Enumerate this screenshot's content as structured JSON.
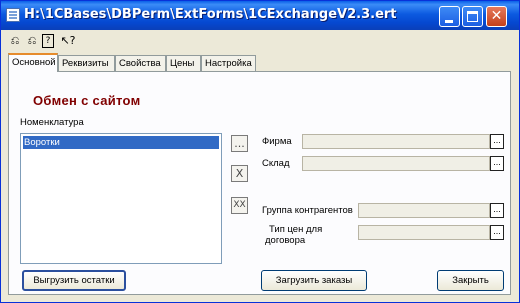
{
  "window": {
    "title": "H:\\1CBases\\DBPerm\\ExtForms\\1CExchangeV2.3.ert",
    "close_glyph": "✕"
  },
  "toolbar": {
    "icons": [
      "⎌",
      "⎌",
      "?",
      "↖?"
    ]
  },
  "tabs": [
    "Основной",
    "Реквизиты",
    "Свойства",
    "Цены",
    "Настройка"
  ],
  "heading": "Обмен с сайтом",
  "nomenclature": {
    "label": "Номенклатура",
    "items": [
      "Воротки"
    ],
    "selected_index": 0
  },
  "side_buttons": {
    "pick": "...",
    "remove": "X",
    "remove_all": "XX"
  },
  "fields": {
    "firm": {
      "label": "Фирма",
      "value": ""
    },
    "warehouse": {
      "label": "Склад",
      "value": ""
    },
    "contractor_group": {
      "label": "Группа контрагентов",
      "value": ""
    },
    "price_type_line1": "Тип цен для",
    "price_type_line2": "договора",
    "price_type_value": "",
    "select_glyph": "..."
  },
  "buttons": {
    "upload_stock": "Выгрузить остатки",
    "load_orders": "Загрузить заказы",
    "close": "Закрыть"
  }
}
